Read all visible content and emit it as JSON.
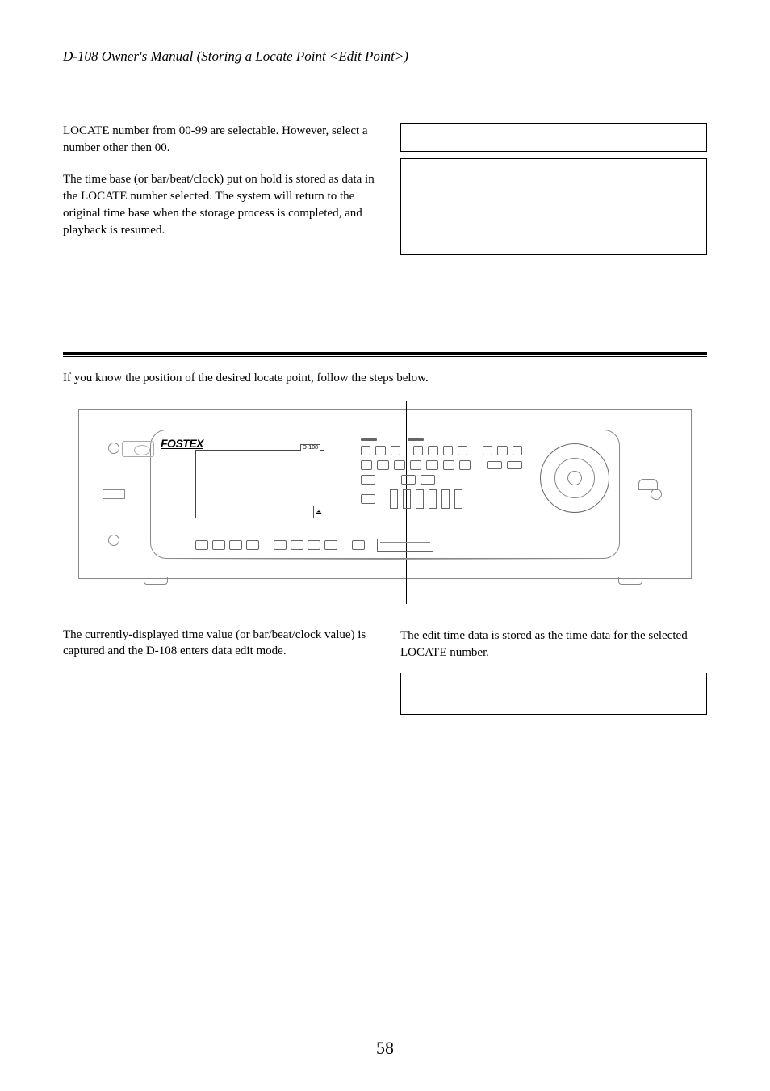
{
  "header": "D-108 Owner's Manual (Storing a Locate Point <Edit Point>)",
  "top_left": {
    "p1": "LOCATE number from 00-99 are selectable.  However, select a number other then 00.",
    "p2": "The time base (or bar/beat/clock) put on hold is stored as data in the LOCATE number selected.  The system will return to the original time base when the storage process is completed, and playback is resumed."
  },
  "mid_text": "If you know the position of the desired locate point, follow the steps below.",
  "device": {
    "brand": "FOSTEX",
    "model": "D-108",
    "eject_symbol": "⏏"
  },
  "bot_left": {
    "p1": "The currently-displayed time value (or bar/beat/clock value) is captured and the D-108 enters data edit mode."
  },
  "bot_right": {
    "p1": "The edit time data is stored as the time data for the selected LOCATE number."
  },
  "page_num": "58"
}
